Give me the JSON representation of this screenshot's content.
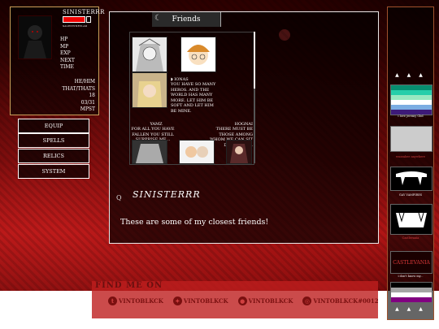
{
  "status": {
    "username": "SINISTERRR",
    "subtitle": "SALENTINEVLAD",
    "stats": [
      "HP",
      "MP",
      "EXP",
      "NEXT",
      "TIME"
    ],
    "info": [
      "HE/HIM",
      "THAT/THATS",
      "18",
      "03/31",
      "MPST"
    ]
  },
  "menu": [
    "EQUIP",
    "SPELLS",
    "RELICS",
    "SYSTEM"
  ],
  "friends_window": {
    "title": "Friends",
    "friend1": {
      "name": "◗ IONAS",
      "text": "YOU HAVE SO MANY HEROS. AND THE WORLD HAS MANY MORE. LET HIM BE SOFT AND LET HIM BE MINE."
    },
    "friend2": {
      "name": "YAMZ",
      "text": "FOR ALL YOU HAVE FALLEN YOU STILL SURPRISE ME..."
    },
    "friend3": {
      "name": "HOGNAI",
      "text": "THERE MUST BE THOSE AMONG WHOM WE CAN SIT DOWN AND..."
    },
    "username": "SINISTERRR",
    "message": "These are some of my closest friends!",
    "deco": "Q"
  },
  "footer": {
    "title": "FIND ME ON",
    "links": [
      "VINTOBLKCK",
      "VINTOBLKCK",
      "VINTOBLKCK",
      "VINTOBLKCK#0012"
    ]
  },
  "sidebar": {
    "arrows": "▲ ▲ ▲",
    "captions": [
      "i love jeremy Gbd",
      "wuzzabee anywhere",
      "GAY VAMPIRES",
      "Castlevania",
      "CASTLEVANIA",
      "ASEXUAL",
      "i don't know my..."
    ]
  },
  "colors": {
    "accent": "#c9a05a",
    "hp": "#e00000",
    "footer": "#be1e1e"
  }
}
